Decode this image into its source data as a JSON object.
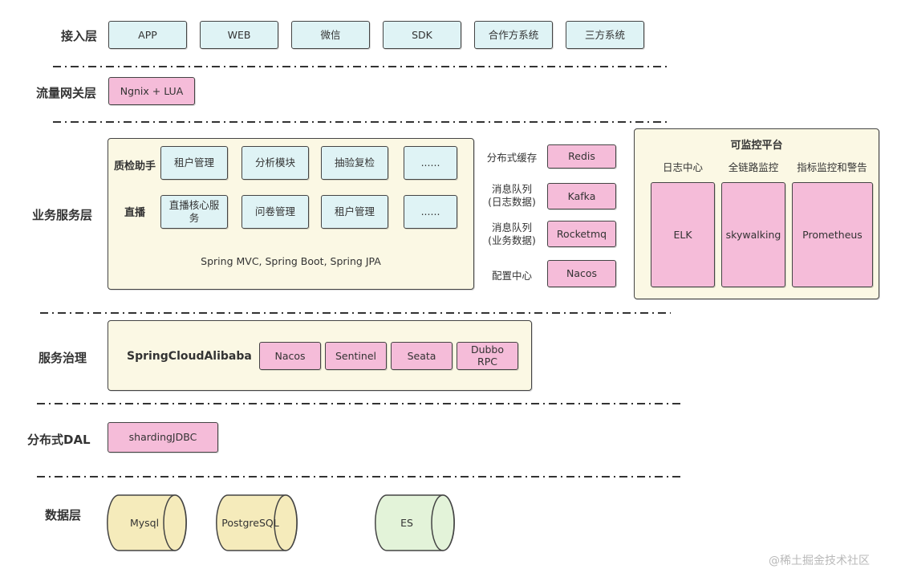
{
  "layers": {
    "access": "接入层",
    "gateway": "流量网关层",
    "business": "业务服务层",
    "governance": "服务治理",
    "dal": "分布式DAL",
    "data": "数据层"
  },
  "access_items": [
    "APP",
    "WEB",
    "微信",
    "SDK",
    "合作方系统",
    "三方系统"
  ],
  "gateway_item": "Ngnix + LUA",
  "business": {
    "rows": [
      {
        "label": "质检助手",
        "items": [
          "租户管理",
          "分析模块",
          "抽验复检",
          "......"
        ]
      },
      {
        "label": "直播",
        "items": [
          "直播核心服务",
          "问卷管理",
          "租户管理",
          "......"
        ]
      }
    ],
    "footer": "Spring MVC, Spring Boot, Spring JPA"
  },
  "middleware": [
    {
      "label": "分布式缓存",
      "value": "Redis"
    },
    {
      "label": "消息队列\n(日志数据)",
      "value": "Kafka"
    },
    {
      "label": "消息队列\n(业务数据)",
      "value": "Rocketmq"
    },
    {
      "label": "配置中心",
      "value": "Nacos"
    }
  ],
  "monitor": {
    "title": "可监控平台",
    "columns": [
      {
        "header": "日志中心",
        "value": "ELK"
      },
      {
        "header": "全链路监控",
        "value": "skywalking"
      },
      {
        "header": "指标监控和警告",
        "value": "Prometheus"
      }
    ]
  },
  "governance": {
    "title": "SpringCloudAlibaba",
    "items": [
      "Nacos",
      "Sentinel",
      "Seata",
      "Dubbo\nRPC"
    ]
  },
  "dal_item": "shardingJDBC",
  "databases": [
    {
      "name": "Mysql",
      "color": "#f5ebbb"
    },
    {
      "name": "PostgreSQL",
      "color": "#f5ebbb"
    },
    {
      "name": "ES",
      "color": "#e3f3d9"
    }
  ],
  "watermark": "@稀土掘金技术社区",
  "colors": {
    "cyan": "#dff3f5",
    "pink": "#f5bcd9",
    "cream": "#fbf8e4"
  }
}
